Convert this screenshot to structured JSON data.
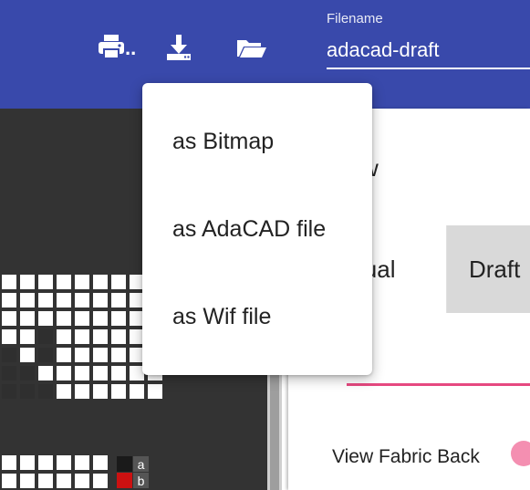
{
  "toolbar": {
    "print_suffix": "..",
    "filename_label": "Filename",
    "filename_value": "adacad-draft"
  },
  "export_menu": {
    "items": [
      {
        "label": "as Bitmap"
      },
      {
        "label": "as AdaCAD file"
      },
      {
        "label": "as Wif file"
      }
    ]
  },
  "right_panel": {
    "title_partial": "w",
    "tabs": [
      {
        "label": "isual"
      },
      {
        "label": "Draft"
      }
    ],
    "view_fabric_back_label": "View Fabric Back"
  },
  "weave_key": {
    "a": "a",
    "b": "b"
  },
  "colors": {
    "toolbar_bg": "#3949ab",
    "canvas_bg": "#333333",
    "accent_pink": "#e64980",
    "warp_red": "#cc1111"
  }
}
